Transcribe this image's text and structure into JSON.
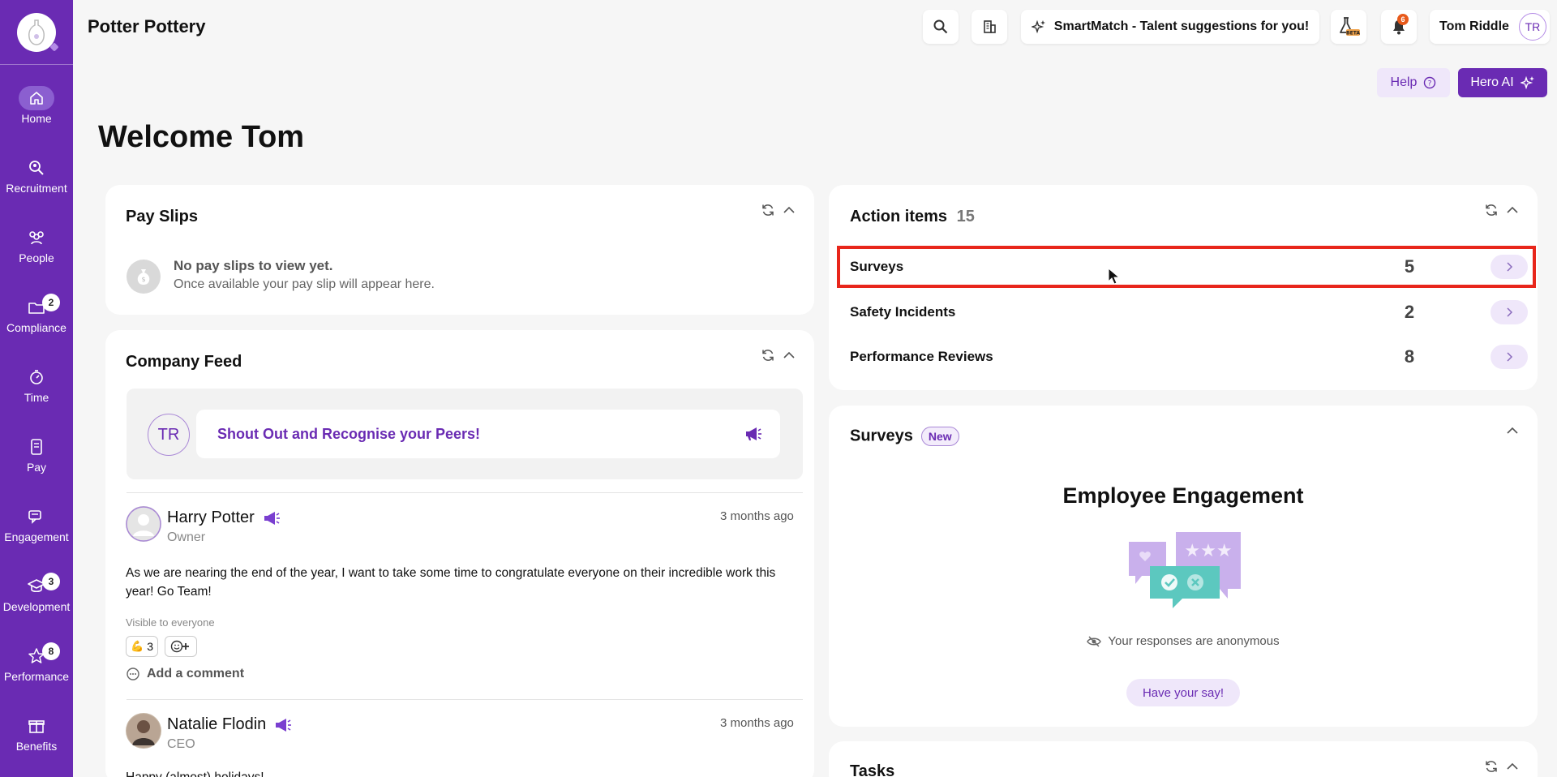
{
  "company": {
    "name": "Potter Pottery"
  },
  "sidebar": {
    "items": [
      {
        "label": "Home",
        "badge": ""
      },
      {
        "label": "Recruitment",
        "badge": ""
      },
      {
        "label": "People",
        "badge": ""
      },
      {
        "label": "Compliance",
        "badge": "2"
      },
      {
        "label": "Time",
        "badge": ""
      },
      {
        "label": "Pay",
        "badge": ""
      },
      {
        "label": "Engagement",
        "badge": ""
      },
      {
        "label": "Development",
        "badge": "3"
      },
      {
        "label": "Performance",
        "badge": "8"
      },
      {
        "label": "Benefits",
        "badge": ""
      }
    ]
  },
  "header": {
    "smartmatch": "SmartMatch - Talent suggestions for you!",
    "beta_label": "BETA",
    "notif_count": "6",
    "user_name": "Tom Riddle",
    "user_initials": "TR",
    "help": "Help",
    "hero_ai": "Hero AI"
  },
  "welcome": "Welcome Tom",
  "payslips": {
    "title": "Pay Slips",
    "empty_title": "No pay slips to view yet.",
    "empty_sub": "Once available your pay slip will appear here."
  },
  "feed": {
    "title": "Company Feed",
    "my_initials": "TR",
    "shoutout": "Shout Out and Recognise your Peers!",
    "posts": [
      {
        "author": "Harry Potter",
        "role": "Owner",
        "time": "3 months ago",
        "body": "As we are nearing the end of the year, I want to take some time to congratulate everyone on their incredible work this year! Go Team!",
        "visibility": "Visible to everyone",
        "reaction_count": "3",
        "add_comment": "Add a comment"
      },
      {
        "author": "Natalie Flodin",
        "role": "CEO",
        "time": "3 months ago",
        "body": "Happy (almost) holidays!"
      }
    ]
  },
  "actions": {
    "title": "Action items",
    "total": "15",
    "items": [
      {
        "label": "Surveys",
        "count": "5"
      },
      {
        "label": "Safety Incidents",
        "count": "2"
      },
      {
        "label": "Performance Reviews",
        "count": "8"
      }
    ]
  },
  "surveys": {
    "title": "Surveys",
    "badge": "New",
    "heading": "Employee Engagement",
    "anon": "Your responses are anonymous",
    "cta": "Have your say!"
  },
  "tasks": {
    "title": "Tasks"
  },
  "colors": {
    "brand": "#6a2bb3",
    "accent_light": "#efe7fa",
    "highlight": "#e8261b"
  }
}
